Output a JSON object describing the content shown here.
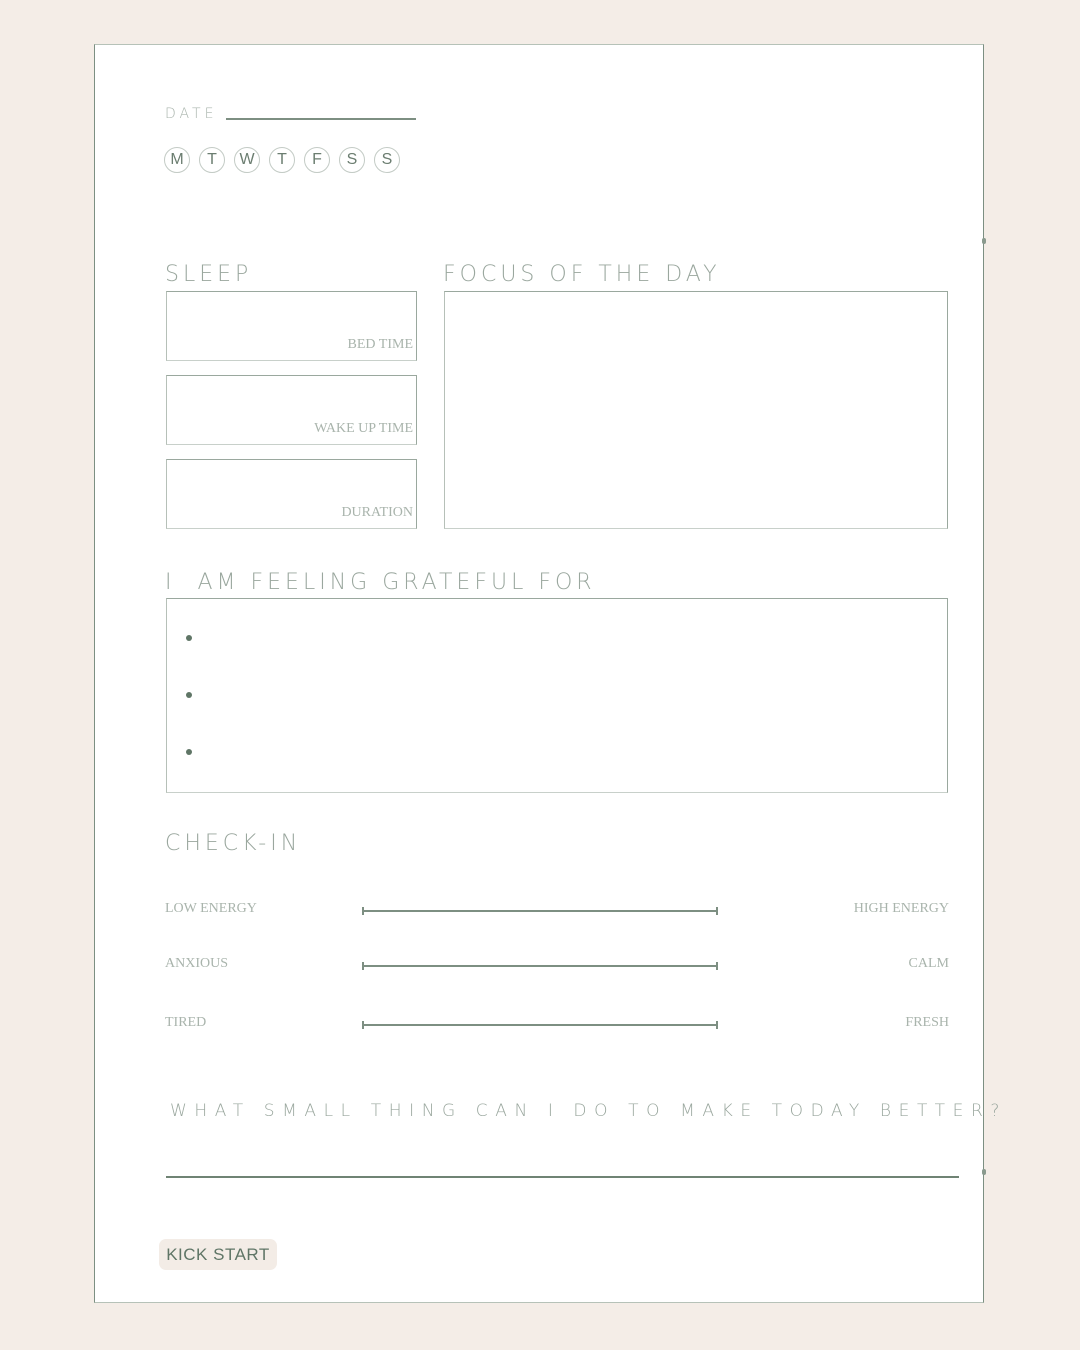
{
  "header": {
    "date_label": "DATE",
    "weekdays": [
      "M",
      "T",
      "W",
      "T",
      "F",
      "S",
      "S"
    ]
  },
  "sleep": {
    "title": "SLEEP",
    "fields": [
      {
        "label": "BED TIME",
        "value": ""
      },
      {
        "label": "WAKE UP TIME",
        "value": ""
      },
      {
        "label": "DURATION",
        "value": ""
      }
    ]
  },
  "focus": {
    "title": "FOCUS OF THE DAY",
    "value": ""
  },
  "gratitude": {
    "title": "I  AM FEELING GRATEFUL FOR",
    "items": [
      "",
      "",
      ""
    ]
  },
  "checkin": {
    "title": "CHECK-IN",
    "scales": [
      {
        "left": "LOW ENERGY",
        "right": "HIGH ENERGY"
      },
      {
        "left": "ANXIOUS",
        "right": "CALM"
      },
      {
        "left": "TIRED",
        "right": "FRESH"
      }
    ]
  },
  "question": {
    "text": "WHAT SMALL THING CAN I DO TO MAKE TODAY BETTER?",
    "answer": ""
  },
  "footer": {
    "tag": "KICK START"
  },
  "colors": {
    "background": "#f4ede7",
    "accent": "#7d8f82",
    "text_light": "#a9b4ac",
    "text_dark": "#5f7566"
  }
}
